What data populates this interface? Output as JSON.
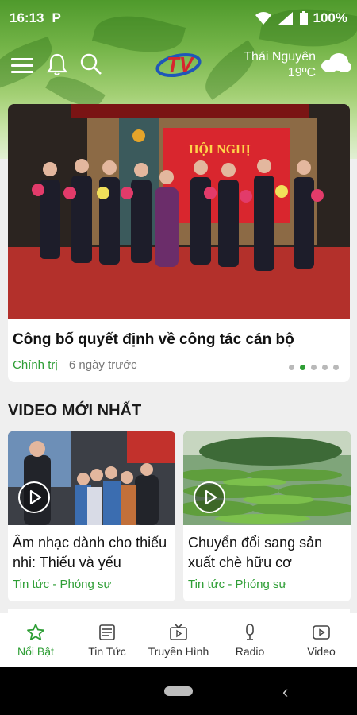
{
  "status_bar": {
    "time": "16:13",
    "carrier_icon": "P",
    "battery": "100%"
  },
  "header": {
    "logo_text": "TV",
    "weather": {
      "city": "Thái Nguyên",
      "temperature": "19ºC",
      "icon": "cloud-icon"
    }
  },
  "featured": {
    "banner_text": "HỘI NGHỊ",
    "title": "Công bố quyết định về công tác cán bộ",
    "category": "Chính trị",
    "time_ago": "6 ngày trước",
    "slides": 5,
    "active_slide": 2
  },
  "latest_videos": {
    "section_title": "VIDEO MỚI NHẤT",
    "items": [
      {
        "title": "Âm nhạc dành cho thiếu nhi: Thiếu và yếu",
        "category": "Tin tức - Phóng sự"
      },
      {
        "title": "Chuyển đổi sang sản xuất chè hữu cơ",
        "category": "Tin tức - Phóng sự"
      }
    ]
  },
  "bottom_nav": [
    {
      "label": "Nổi Bật",
      "icon": "star-icon",
      "active": true
    },
    {
      "label": "Tin Tức",
      "icon": "news-icon",
      "active": false
    },
    {
      "label": "Truyền Hình",
      "icon": "tv-icon",
      "active": false
    },
    {
      "label": "Radio",
      "icon": "microphone-icon",
      "active": false
    },
    {
      "label": "Video",
      "icon": "video-play-icon",
      "active": false
    }
  ],
  "colors": {
    "accent": "#2e9e35",
    "header_green": "#6aaf3d",
    "logo_red": "#d7262e",
    "logo_blue": "#1f57b8"
  }
}
